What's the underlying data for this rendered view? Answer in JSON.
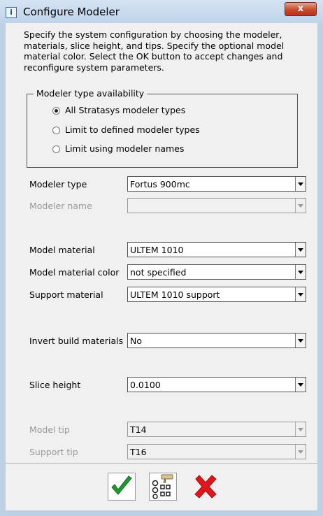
{
  "window": {
    "title": "Configure Modeler",
    "info_icon": "info-icon",
    "close_icon": "close-icon",
    "close_glyph": "x"
  },
  "description": "Specify the system configuration by choosing the modeler, materials, slice height, and tips. Specify the optional model material color. Select the OK button to accept changes and reconfigure system parameters.",
  "modeler_type_availability": {
    "legend": "Modeler type availability",
    "options": [
      {
        "label": "All Stratasys modeler types",
        "selected": true
      },
      {
        "label": "Limit to defined modeler types",
        "selected": false
      },
      {
        "label": "Limit using modeler names",
        "selected": false
      }
    ]
  },
  "fields": {
    "modeler_type": {
      "label": "Modeler type",
      "value": "Fortus 900mc",
      "enabled": true
    },
    "modeler_name": {
      "label": "Modeler name",
      "value": "",
      "enabled": false
    },
    "model_material": {
      "label": "Model material",
      "value": "ULTEM 1010",
      "enabled": true
    },
    "model_material_color": {
      "label": "Model material color",
      "value": "not specified",
      "enabled": true
    },
    "support_material": {
      "label": "Support material",
      "value": "ULTEM 1010 support",
      "enabled": true
    },
    "invert_build_materials": {
      "label": "Invert build materials",
      "value": "No",
      "enabled": true
    },
    "slice_height": {
      "label": "Slice height",
      "value": "0.0100",
      "enabled": true
    },
    "model_tip": {
      "label": "Model tip",
      "value": "T14",
      "enabled": false
    },
    "support_tip": {
      "label": "Support tip",
      "value": "T16",
      "enabled": false
    }
  },
  "buttons": {
    "ok_icon": "green-checkmark-icon",
    "tips_icon": "modeler-settings-icon",
    "cancel_icon": "red-x-icon"
  },
  "colors": {
    "ok_green": "#1f9a2e",
    "cancel_red": "#e0161c",
    "titlebar": "#c6d9ec"
  }
}
